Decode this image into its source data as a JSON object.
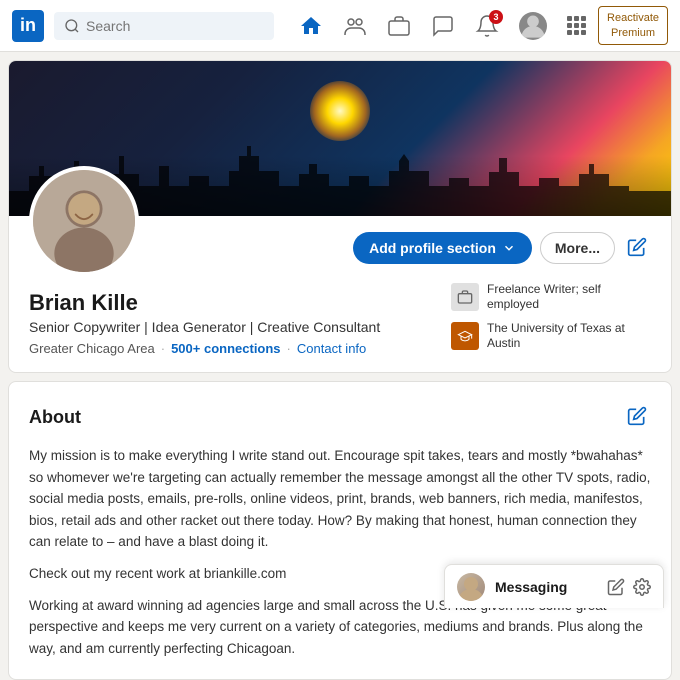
{
  "navbar": {
    "logo_text": "in",
    "search_placeholder": "Search",
    "nav_items": [
      {
        "id": "home",
        "label": "Home",
        "badge": null
      },
      {
        "id": "network",
        "label": "My Network",
        "badge": null
      },
      {
        "id": "jobs",
        "label": "Jobs",
        "badge": null
      },
      {
        "id": "messaging",
        "label": "Messaging",
        "badge": null
      },
      {
        "id": "notifications",
        "label": "Notifications",
        "badge": "3"
      },
      {
        "id": "me",
        "label": "Me",
        "badge": null
      },
      {
        "id": "grid",
        "label": "Work",
        "badge": null
      }
    ],
    "reactivate_line1": "Reactivate",
    "reactivate_line2": "Premium"
  },
  "profile": {
    "name": "Brian Kille",
    "headline": "Senior Copywriter | Idea Generator | Creative Consultant",
    "location": "Greater Chicago Area",
    "connections": "500+ connections",
    "contact_info": "Contact info",
    "add_section_label": "Add profile section",
    "more_label": "More...",
    "experience": [
      {
        "icon_type": "grey",
        "text": "Freelance Writer; self employed"
      },
      {
        "icon_type": "orange",
        "text": "The University of Texas at Austin"
      }
    ]
  },
  "about": {
    "title": "About",
    "paragraphs": [
      "My mission is to make everything I write stand out. Encourage spit takes, tears and mostly *bwahahas* so whomever we're targeting can actually remember the message amongst all the other TV spots, radio, social media posts, emails, pre-rolls, online videos, print, brands, web banners, rich media, manifestos, bios, retail ads and other racket out there today. How? By making that honest, human connection they can relate to – and have a blast doing it.",
      "Check out my recent work at briankille.com",
      "Working at award winning ad agencies large and small across the U.S. has given me some great perspective and keeps me very current on a variety of categories, mediums and brands. Plus along the way, and am currently perfecting Chicagoan."
    ]
  },
  "messaging": {
    "label": "Messaging"
  }
}
